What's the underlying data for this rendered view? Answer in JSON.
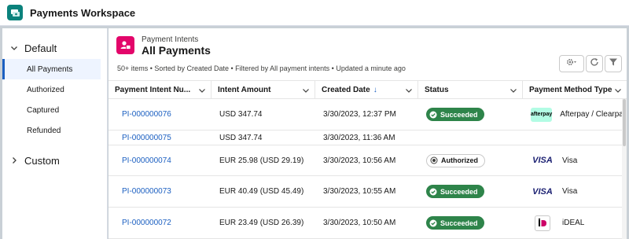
{
  "app": {
    "title": "Payments Workspace",
    "icon": "payments-app-icon",
    "accent": "#0b827c"
  },
  "sidebar": {
    "sections": [
      {
        "label": "Default",
        "expanded": true
      },
      {
        "label": "Custom",
        "expanded": false
      }
    ],
    "items": [
      {
        "label": "All Payments",
        "active": true
      },
      {
        "label": "Authorized"
      },
      {
        "label": "Captured"
      },
      {
        "label": "Refunded"
      }
    ]
  },
  "header": {
    "object_label": "Payment Intents",
    "list_title": "All Payments",
    "meta": "50+ items • Sorted by Created Date • Filtered by All payment intents • Updated a minute ago",
    "object_icon_color": "#e3066a"
  },
  "toolbar": {
    "settings_icon": "gear-icon",
    "refresh_icon": "refresh-icon",
    "filter_icon": "filter-icon"
  },
  "table": {
    "columns": [
      "Payment Intent Nu...",
      "Intent Amount",
      "Created Date",
      "Status",
      "Payment Method Type"
    ],
    "sorted_column": "Created Date",
    "sort_direction": "descending",
    "rows": [
      {
        "id": "PI-000000076",
        "amount": "USD 347.74",
        "date": "3/30/2023, 12:37 PM",
        "status": "Succeeded",
        "method": "Afterpay / Clearpay",
        "method_logo": "afterpay"
      },
      {
        "id": "PI-000000075",
        "amount": "USD 347.74",
        "date": "3/30/2023, 11:36 AM",
        "status": "",
        "method": "",
        "method_logo": ""
      },
      {
        "id": "PI-000000074",
        "amount": "EUR 25.98 (USD 29.19)",
        "date": "3/30/2023, 10:56 AM",
        "status": "Authorized",
        "method": "Visa",
        "method_logo": "VISA"
      },
      {
        "id": "PI-000000073",
        "amount": "EUR 40.49 (USD 45.49)",
        "date": "3/30/2023, 10:55 AM",
        "status": "Succeeded",
        "method": "Visa",
        "method_logo": "VISA"
      },
      {
        "id": "PI-000000072",
        "amount": "EUR 23.49 (USD 26.39)",
        "date": "3/30/2023, 10:50 AM",
        "status": "Succeeded",
        "method": "iDEAL",
        "method_logo": "ideal"
      }
    ]
  },
  "logos": {
    "afterpay": "afterpay",
    "visa": "VISA"
  },
  "colors": {
    "link": "#1b5fc1",
    "success": "#2e844a"
  }
}
